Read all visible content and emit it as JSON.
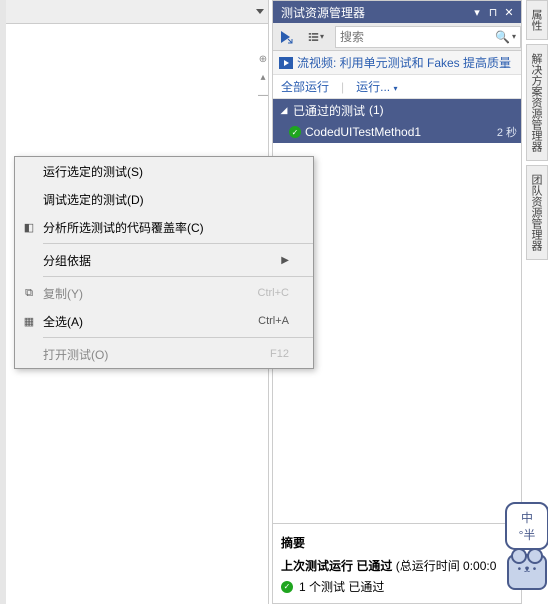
{
  "panel": {
    "title": "测试资源管理器",
    "search_placeholder": "搜索",
    "video_label": "流视频: 利用单元测试和 Fakes 提高质量",
    "run_all": "全部运行",
    "run_menu": "运行...",
    "group": {
      "label": "已通过的测试",
      "count": "(1)"
    },
    "tests": [
      {
        "name": "CodedUITestMethod1",
        "duration": "2 秒",
        "status": "pass"
      }
    ],
    "summary": {
      "title": "摘要",
      "lastrun_label": "上次测试运行",
      "lastrun_status": "已通过",
      "lastrun_time": "(总运行时间 0:00:0",
      "pass_line": "1 个测试 已通过"
    }
  },
  "context_menu": {
    "items": [
      {
        "label": "运行选定的测试(S)",
        "enabled": true,
        "icon": ""
      },
      {
        "label": "调试选定的测试(D)",
        "enabled": true,
        "icon": ""
      },
      {
        "label": "分析所选测试的代码覆盖率(C)",
        "enabled": true,
        "icon": "◧"
      },
      {
        "sep": true
      },
      {
        "label": "分组依据",
        "enabled": true,
        "icon": "",
        "submenu": true
      },
      {
        "sep": true
      },
      {
        "label": "复制(Y)",
        "enabled": false,
        "icon": "⧉",
        "shortcut": "Ctrl+C"
      },
      {
        "label": "全选(A)",
        "enabled": true,
        "icon": "▦",
        "shortcut": "Ctrl+A"
      },
      {
        "sep": true
      },
      {
        "label": "打开测试(O)",
        "enabled": false,
        "icon": "",
        "shortcut": "F12"
      }
    ]
  },
  "side_tabs": [
    "属性",
    "解决方案资源管理器",
    "团队资源管理器"
  ],
  "mascot": {
    "top": "中",
    "bottom": "°半"
  }
}
